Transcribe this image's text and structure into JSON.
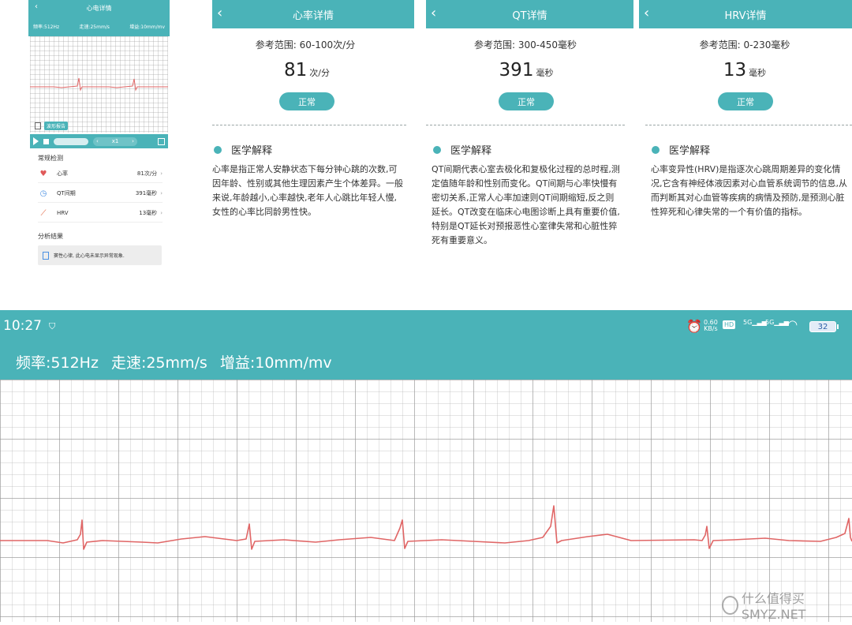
{
  "small_phone": {
    "title": "心电详情",
    "back": "‹",
    "info": {
      "rate": "频率:512Hz",
      "speed": "走速:25mm/s",
      "gain": "增益:10mm/mv"
    },
    "report_label": "波形报告",
    "player": {
      "speed_left": "‹",
      "speed": "x1",
      "speed_right": "›"
    },
    "section_routine": "常规检测",
    "rows": [
      {
        "icon": "heart-icon",
        "label": "心率",
        "value": "81次/分"
      },
      {
        "icon": "clock-icon",
        "label": "QT间期",
        "value": "391毫秒"
      },
      {
        "icon": "chart-icon",
        "label": "HRV",
        "value": "13毫秒"
      }
    ],
    "chevron": "›",
    "section_result": "分析结果",
    "result_text": "窦性心律, 此心电未显示异常现象."
  },
  "panels": [
    {
      "title": "心率详情",
      "back": "‹",
      "reference": "参考范围: 60-100次/分",
      "value": "81",
      "unit": "次/分",
      "status": "正常",
      "explain_title": "医学解释",
      "explanation": "心率是指正常人安静状态下每分钟心跳的次数,可因年龄、性别或其他生理因素产生个体差异。一般来说,年龄越小,心率越快,老年人心跳比年轻人慢,女性的心率比同龄男性快。"
    },
    {
      "title": "QT详情",
      "back": "‹",
      "reference": "参考范围: 300-450毫秒",
      "value": "391",
      "unit": "毫秒",
      "status": "正常",
      "explain_title": "医学解释",
      "explanation": "QT间期代表心室去极化和复极化过程的总时程,测定值随年龄和性别而变化。QT间期与心率快慢有密切关系,正常人心率加速则QT间期缩短,反之则延长。QT改变在临床心电图诊断上具有重要价值,特别是QT延长对预报恶性心室律失常和心脏性猝死有重要意义。"
    },
    {
      "title": "HRV详情",
      "back": "‹",
      "reference": "参考范围: 0-230毫秒",
      "value": "13",
      "unit": "毫秒",
      "status": "正常",
      "explain_title": "医学解释",
      "explanation": "心率变异性(HRV)是指逐次心跳周期差异的变化情况,它含有神经体液因素对心血管系统调节的信息,从而判断其对心血管等疾病的病情及预防,是预测心脏性猝死和心律失常的一个有价值的指标。"
    }
  ],
  "big_phone": {
    "status_bar": {
      "time": "10:27",
      "speed_value": "0.60",
      "speed_unit": "KB/s",
      "hd": "HD",
      "sim1": "5G",
      "sim2": "5G",
      "battery": "32"
    },
    "info": {
      "rate": "频率:512Hz",
      "speed": "走速:25mm/s",
      "gain": "增益:10mm/mv"
    }
  },
  "watermark": "什么值得买 SMYZ.NET",
  "colors": {
    "accent": "#4ab3b8",
    "ecg_trace": "#e06666",
    "grid": "#bbbbbb"
  }
}
